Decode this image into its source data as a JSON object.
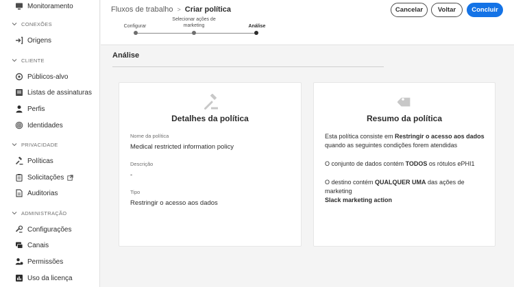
{
  "sidebar": {
    "items": [
      {
        "label": "Monitoramento",
        "icon": "monitor-icon"
      },
      {
        "section": "CONEXÕES"
      },
      {
        "label": "Origens",
        "icon": "sign-in-icon"
      },
      {
        "section": "CLIENTE"
      },
      {
        "label": "Públicos-alvo",
        "icon": "audience-icon"
      },
      {
        "label": "Listas de assinaturas",
        "icon": "list-icon"
      },
      {
        "label": "Perfis",
        "icon": "person-icon"
      },
      {
        "label": "Identidades",
        "icon": "fingerprint-icon"
      },
      {
        "section": "PRIVACIDADE"
      },
      {
        "label": "Políticas",
        "icon": "gavel-icon"
      },
      {
        "label": "Solicitações",
        "icon": "clipboard-icon",
        "external": true
      },
      {
        "label": "Auditorias",
        "icon": "document-icon"
      },
      {
        "section": "ADMINISTRAÇÃO"
      },
      {
        "label": "Configurações",
        "icon": "settings-icon"
      },
      {
        "label": "Canais",
        "icon": "channels-icon"
      },
      {
        "label": "Permissões",
        "icon": "permissions-icon"
      },
      {
        "label": "Uso da licença",
        "icon": "license-icon"
      }
    ]
  },
  "header": {
    "breadcrumb": [
      "Fluxos de trabalho",
      "Criar política"
    ],
    "steps": [
      {
        "label": "Configurar"
      },
      {
        "label_line1": "Selecionar ações de",
        "label_line2": "marketing"
      },
      {
        "label": "Análise",
        "current": true
      }
    ],
    "buttons": {
      "cancel": "Cancelar",
      "back": "Voltar",
      "finish": "Concluir"
    }
  },
  "main": {
    "section_title": "Análise",
    "details_card": {
      "title": "Detalhes da política",
      "icon": "gavel-icon",
      "fields": [
        {
          "label": "Nome da política",
          "value": "Medical restricted information policy"
        },
        {
          "label": "Descrição",
          "value": "-"
        },
        {
          "label": "Tipo",
          "value": "Restringir o acesso aos dados"
        }
      ]
    },
    "summary_card": {
      "title": "Resumo da política",
      "icon": "tag-icon",
      "p1_a": "Esta política consiste em ",
      "p1_b": "Restringir o acesso aos dados",
      "p1_c": " quando as seguintes condições forem atendidas",
      "p2_a": "O conjunto de dados contém ",
      "p2_b": "TODOS",
      "p2_c": " os rótulos ePHI1",
      "p3_a": "O destino contém ",
      "p3_b": "QUALQUER UMA",
      "p3_c": " das ações de marketing",
      "p3_d": "Slack marketing action"
    }
  },
  "colors": {
    "accent": "#1473e6",
    "text": "#2c2c2c",
    "muted": "#6e6e6e",
    "background": "#f4f4f4"
  }
}
